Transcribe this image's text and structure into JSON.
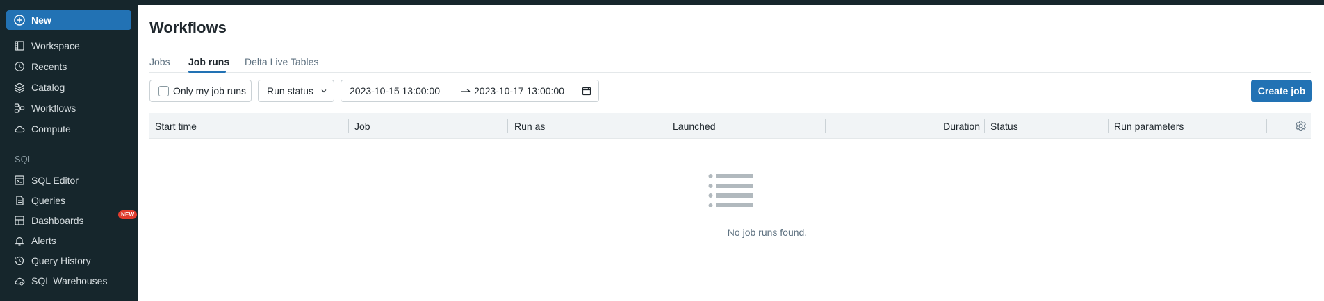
{
  "sidebar": {
    "new_label": "New",
    "items": [
      {
        "label": "Workspace",
        "icon": "workspace-icon"
      },
      {
        "label": "Recents",
        "icon": "clock-icon"
      },
      {
        "label": "Catalog",
        "icon": "catalog-icon"
      },
      {
        "label": "Workflows",
        "icon": "workflows-icon"
      },
      {
        "label": "Compute",
        "icon": "cloud-icon"
      }
    ],
    "sql_section_label": "SQL",
    "sql_items": [
      {
        "label": "SQL Editor",
        "icon": "sql-editor-icon"
      },
      {
        "label": "Queries",
        "icon": "queries-icon"
      },
      {
        "label": "Dashboards",
        "icon": "dashboards-icon",
        "badge": "NEW"
      },
      {
        "label": "Alerts",
        "icon": "bell-icon"
      },
      {
        "label": "Query History",
        "icon": "history-icon"
      },
      {
        "label": "SQL Warehouses",
        "icon": "warehouse-icon"
      }
    ]
  },
  "page": {
    "title": "Workflows",
    "tabs": [
      {
        "label": "Jobs",
        "active": false
      },
      {
        "label": "Job runs",
        "active": true
      },
      {
        "label": "Delta Live Tables",
        "active": false
      }
    ]
  },
  "filters": {
    "only_my_runs_label": "Only my job runs",
    "run_status_label": "Run status",
    "start_date": "2023-10-15 13:00:00",
    "end_date": "2023-10-17 13:00:00",
    "create_job_label": "Create job"
  },
  "table": {
    "columns": [
      "Start time",
      "Job",
      "Run as",
      "Launched",
      "Duration",
      "Status",
      "Run parameters"
    ],
    "empty_message": "No job runs found."
  },
  "colors": {
    "accent": "#2272b4",
    "sidebar_bg": "#16262c",
    "badge": "#e03b2d"
  }
}
